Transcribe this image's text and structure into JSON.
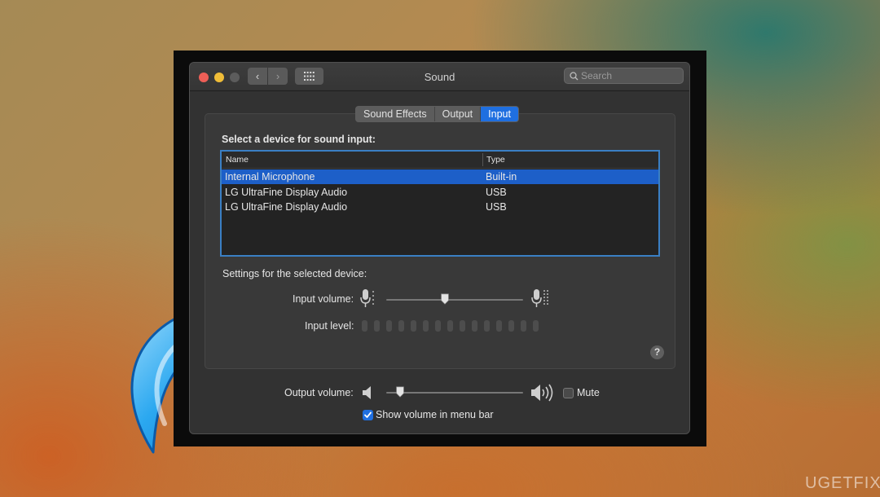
{
  "window": {
    "title": "Sound",
    "search_placeholder": "Search",
    "nav_back": "‹",
    "nav_forward": "›"
  },
  "tabs": [
    {
      "label": "Sound Effects",
      "selected": false
    },
    {
      "label": "Output",
      "selected": false
    },
    {
      "label": "Input",
      "selected": true
    }
  ],
  "input": {
    "select_device_label": "Select a device for sound input:",
    "table": {
      "columns": [
        "Name",
        "Type"
      ],
      "rows": [
        {
          "name": "Internal Microphone",
          "type": "Built-in",
          "selected": true
        },
        {
          "name": "LG UltraFine Display Audio",
          "type": "USB",
          "selected": false
        },
        {
          "name": "LG UltraFine Display Audio",
          "type": "USB",
          "selected": false
        }
      ]
    },
    "settings_label": "Settings for the selected device:",
    "input_volume_label": "Input volume:",
    "input_volume_value": 0.43,
    "input_level_label": "Input level:",
    "input_level_segments": 15,
    "input_level_active": 0
  },
  "output": {
    "output_volume_label": "Output volume:",
    "output_volume_value": 0.1,
    "mute_label": "Mute",
    "mute_checked": false,
    "show_volume_label": "Show volume in menu bar",
    "show_volume_checked": true
  },
  "help_label": "?",
  "watermark": "UGETFIX",
  "colors": {
    "accent": "#1f6fe0",
    "selection": "#1d5fc8",
    "arrow": "#2ba8f0"
  }
}
